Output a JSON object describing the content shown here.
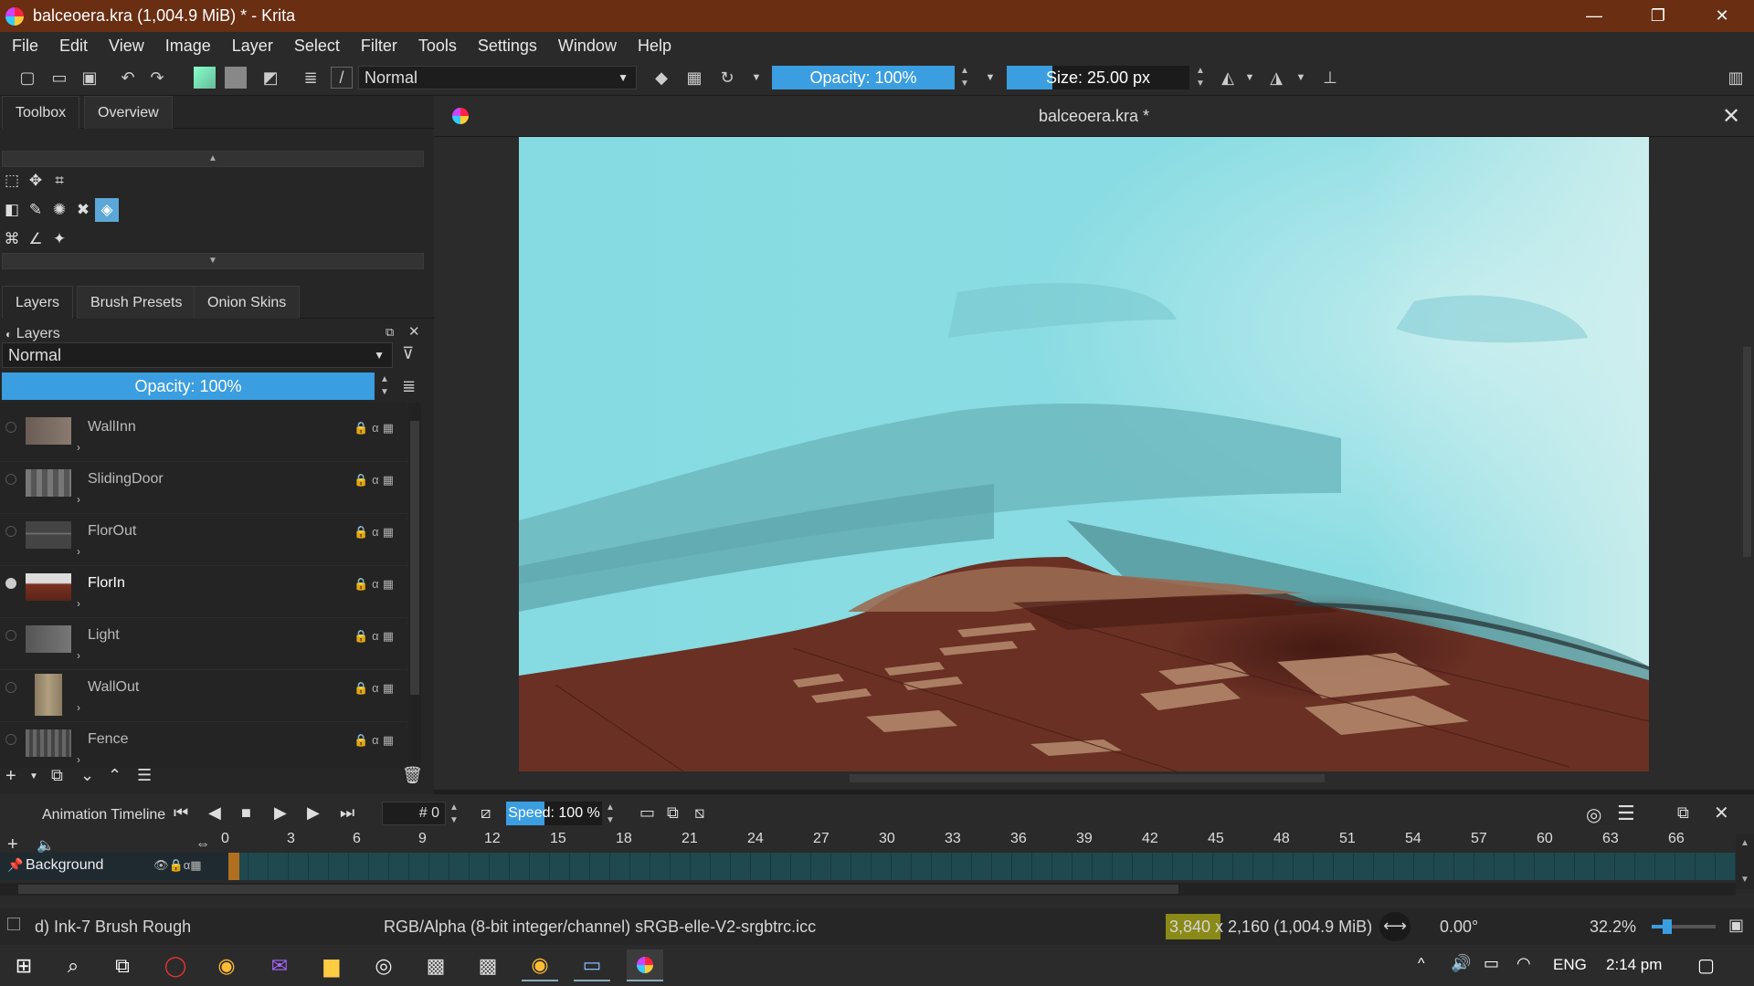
{
  "window": {
    "title": "balceoera.kra (1,004.9 MiB)  * - Krita",
    "minimize": "—",
    "restore": "❐",
    "close": "✕"
  },
  "menu": [
    "File",
    "Edit",
    "View",
    "Image",
    "Layer",
    "Select",
    "Filter",
    "Tools",
    "Settings",
    "Window",
    "Help"
  ],
  "toolbar": {
    "blend_mode": "Normal",
    "opacity": "Opacity: 100%",
    "size": "Size: 25.00 px"
  },
  "docker_tabs": {
    "toolbox": "Toolbox",
    "overview": "Overview"
  },
  "layers_tabs": {
    "layers": "Layers",
    "brush_presets": "Brush Presets",
    "onion_skins": "Onion Skins"
  },
  "layers_panel": {
    "title": "Layers",
    "blend_mode": "Normal",
    "opacity": "Opacity:  100%"
  },
  "layers": [
    {
      "name": "WallInn",
      "visible": false
    },
    {
      "name": "SlidingDoor",
      "visible": false
    },
    {
      "name": "FlorOut",
      "visible": false
    },
    {
      "name": "FlorIn",
      "visible": true
    },
    {
      "name": "Light",
      "visible": false
    },
    {
      "name": "WallOut",
      "visible": false
    },
    {
      "name": "Fence",
      "visible": false
    }
  ],
  "document": {
    "tab_title": "balceoera.kra *"
  },
  "timeline": {
    "title": "Animation Timeline",
    "frame_label": "# 0",
    "speed": "Speed: 100 %",
    "ticks": [
      "0",
      "3",
      "6",
      "9",
      "12",
      "15",
      "18",
      "21",
      "24",
      "27",
      "30",
      "33",
      "36",
      "39",
      "42",
      "45",
      "48",
      "51",
      "54",
      "57",
      "60",
      "63",
      "66"
    ],
    "layer_name": "Background"
  },
  "status": {
    "brush": "d) Ink-7 Brush Rough",
    "color_space": "RGB/Alpha (8-bit integer/channel)  sRGB-elle-V2-srgbtrc.icc",
    "dimensions": "3,840 x 2,160 (1,004.9 MiB)",
    "rotation": "0.00°",
    "zoom": "32.2%"
  },
  "taskbar": {
    "language": "ENG",
    "time": "2:14 pm"
  },
  "colors": {
    "titlebar": "#6a2e12",
    "accent": "#3a9ee0",
    "sky": "#8adde3",
    "floor": "#6a3024"
  }
}
